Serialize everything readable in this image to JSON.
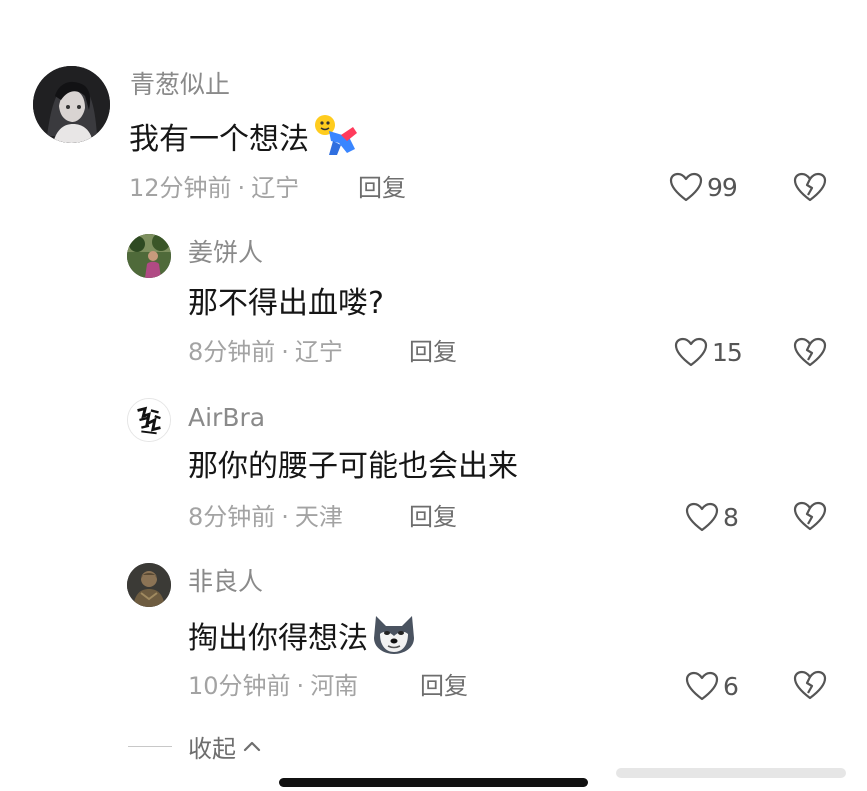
{
  "comments": [
    {
      "username": "青葱似止",
      "text": "我有一个想法",
      "emoji": "sliding-doll-emoji",
      "time": "12分钟前",
      "location": "辽宁",
      "reply_label": "回复",
      "likes": "99"
    },
    {
      "username": "姜饼人",
      "text": "那不得出血喽?",
      "time": "8分钟前",
      "location": "辽宁",
      "reply_label": "回复",
      "likes": "15"
    },
    {
      "username": "AirBra",
      "text": "那你的腰子可能也会出来",
      "time": "8分钟前",
      "location": "天津",
      "reply_label": "回复",
      "likes": "8"
    },
    {
      "username": "非良人",
      "text": "掏出你得想法",
      "emoji": "husky-face-emoji",
      "time": "10分钟前",
      "location": "河南",
      "reply_label": "回复",
      "likes": "6"
    }
  ],
  "collapse_label": "收起",
  "separator": "·",
  "icons": {
    "like": "heart-outline-icon",
    "dislike": "broken-heart-icon",
    "collapse": "chevron-up-icon"
  },
  "colors": {
    "text_primary": "#161616",
    "text_secondary": "#8a8a8a",
    "icon_gray": "#555555"
  }
}
